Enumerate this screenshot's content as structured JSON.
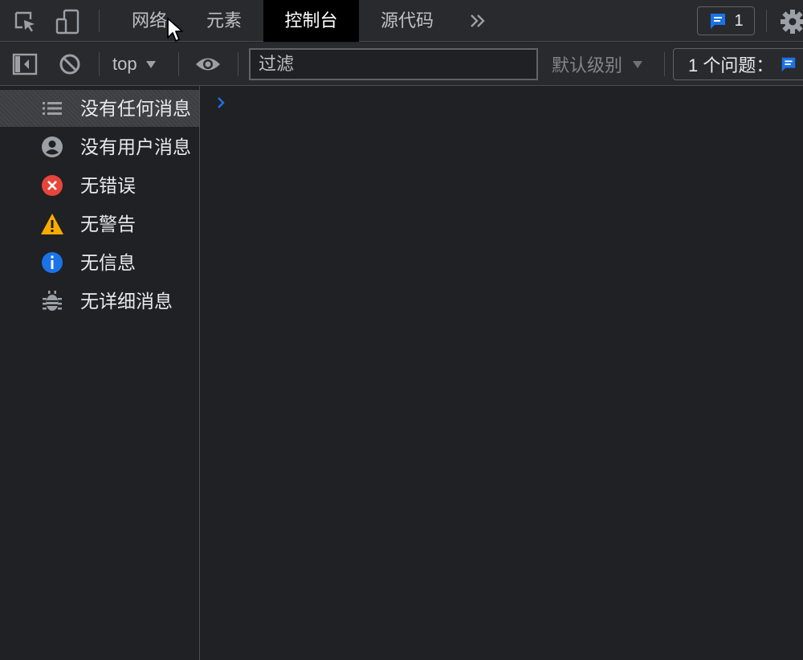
{
  "tabbar": {
    "tabs": [
      {
        "label": "网络"
      },
      {
        "label": "元素"
      },
      {
        "label": "控制台",
        "active": true
      },
      {
        "label": "源代码"
      }
    ],
    "more_icon": "chevron-double-right-icon",
    "issues_count": "1"
  },
  "toolbar": {
    "context": "top",
    "filter_placeholder": "过滤",
    "level": "默认级别",
    "issues_text": "1 个问题："
  },
  "sidebar": {
    "items": [
      {
        "label": "没有任何消息",
        "icon": "list-icon",
        "selected": true
      },
      {
        "label": "没有用户消息",
        "icon": "user-circle-icon"
      },
      {
        "label": "无错误",
        "icon": "error-icon"
      },
      {
        "label": "无警告",
        "icon": "warning-icon"
      },
      {
        "label": "无信息",
        "icon": "info-icon"
      },
      {
        "label": "无详细消息",
        "icon": "bug-icon"
      }
    ]
  },
  "colors": {
    "background": "#202124",
    "toolbar": "#292a2d",
    "accent_blue": "#1a73e8",
    "error_red": "#e8453c",
    "warning_yellow": "#f9ab00"
  }
}
